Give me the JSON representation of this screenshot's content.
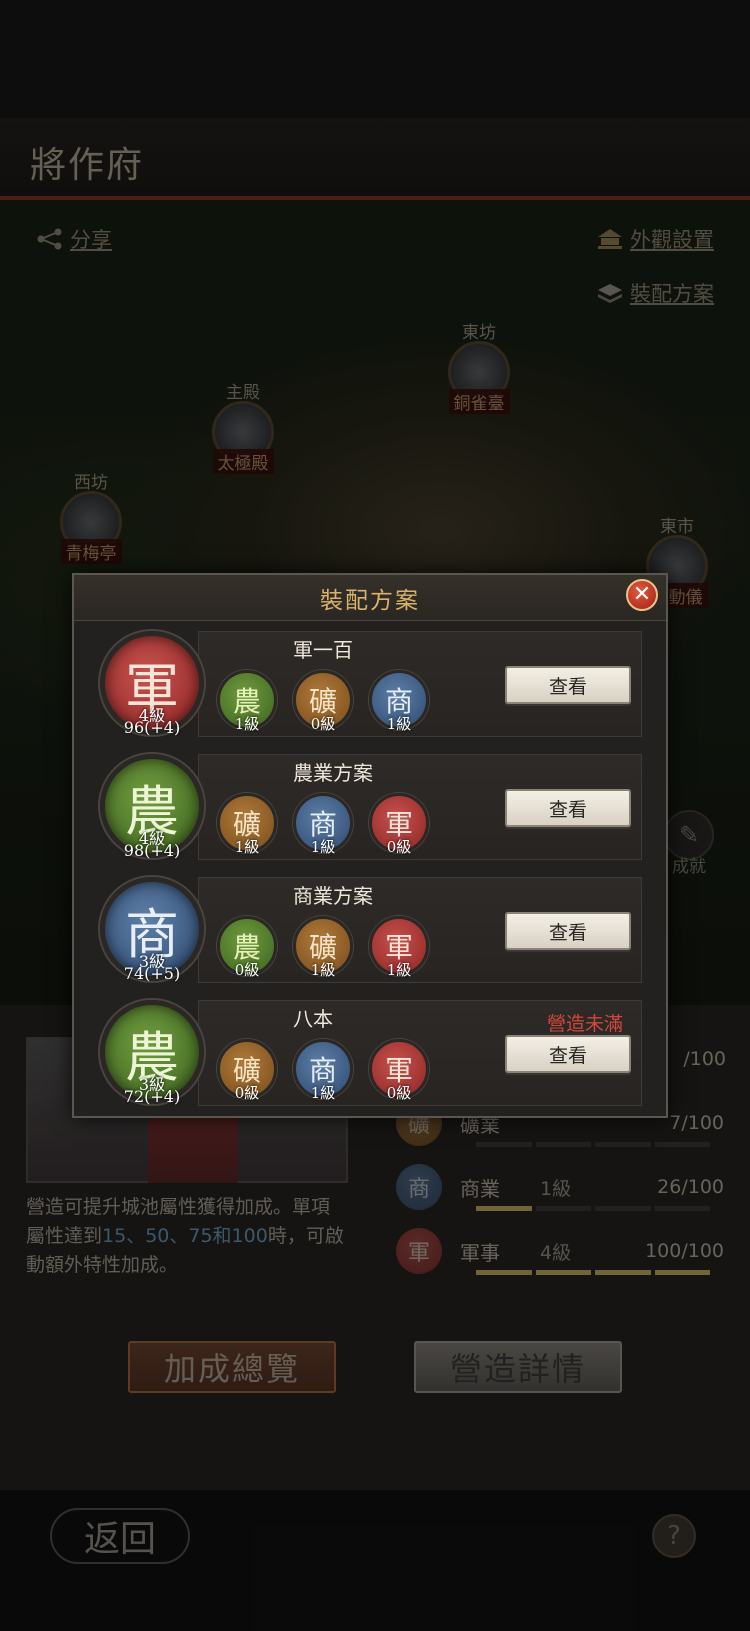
{
  "header": {
    "title": "將作府"
  },
  "map": {
    "share_label": "分享",
    "appearance_label": "外觀設置",
    "loadout_label": "裝配方案",
    "pois": [
      {
        "top": "東坊",
        "name": "銅雀臺"
      },
      {
        "top": "主殿",
        "name": "太極殿"
      },
      {
        "top": "西坊",
        "name": "青梅亭"
      },
      {
        "top": "東市",
        "name": "地動儀"
      }
    ],
    "achievement_label": "成就"
  },
  "lower": {
    "description_1": "營造可提升城池屬性獲得加成。單項屬性達到",
    "thresholds": "15、50、75和100",
    "description_2": "時，可啟動額外特性加成。",
    "attributes": [
      {
        "icon": "礦",
        "name": "礦業",
        "level": "",
        "value": "7/100",
        "progress": 0.07,
        "color": "#7a4d1c"
      },
      {
        "icon": "商",
        "name": "商業",
        "level": "1級",
        "value": "26/100",
        "progress": 0.26,
        "color": "#2e4b72"
      },
      {
        "icon": "軍",
        "name": "軍事",
        "level": "4級",
        "value": "100/100",
        "progress": 1.0,
        "color": "#8e2524"
      }
    ],
    "first_row_value": "/100",
    "bonus_button": "加成總覽",
    "detail_button": "營造詳情"
  },
  "footer": {
    "back_label": "返回",
    "help_label": "?"
  },
  "modal": {
    "title": "裝配方案",
    "view_label": "查看",
    "plans": [
      {
        "name": "軍一百",
        "status": "",
        "main": {
          "char": "軍",
          "level": "4級",
          "score": "96(+4)",
          "color": "red"
        },
        "subs": [
          {
            "char": "農",
            "level": "1級",
            "color": "green"
          },
          {
            "char": "礦",
            "level": "0級",
            "color": "orange"
          },
          {
            "char": "商",
            "level": "1級",
            "color": "blue"
          }
        ]
      },
      {
        "name": "農業方案",
        "status": "",
        "main": {
          "char": "農",
          "level": "4級",
          "score": "98(+4)",
          "color": "green"
        },
        "subs": [
          {
            "char": "礦",
            "level": "1級",
            "color": "orange"
          },
          {
            "char": "商",
            "level": "1級",
            "color": "blue"
          },
          {
            "char": "軍",
            "level": "0級",
            "color": "red"
          }
        ]
      },
      {
        "name": "商業方案",
        "status": "",
        "main": {
          "char": "商",
          "level": "3級",
          "score": "74(+5)",
          "color": "blue"
        },
        "subs": [
          {
            "char": "農",
            "level": "0級",
            "color": "green"
          },
          {
            "char": "礦",
            "level": "1級",
            "color": "orange"
          },
          {
            "char": "軍",
            "level": "1級",
            "color": "red"
          }
        ]
      },
      {
        "name": "八本",
        "status": "營造未滿",
        "main": {
          "char": "農",
          "level": "3級",
          "score": "72(+4)",
          "color": "green"
        },
        "subs": [
          {
            "char": "礦",
            "level": "0級",
            "color": "orange"
          },
          {
            "char": "商",
            "level": "1級",
            "color": "blue"
          },
          {
            "char": "軍",
            "level": "0級",
            "color": "red"
          }
        ]
      }
    ]
  }
}
